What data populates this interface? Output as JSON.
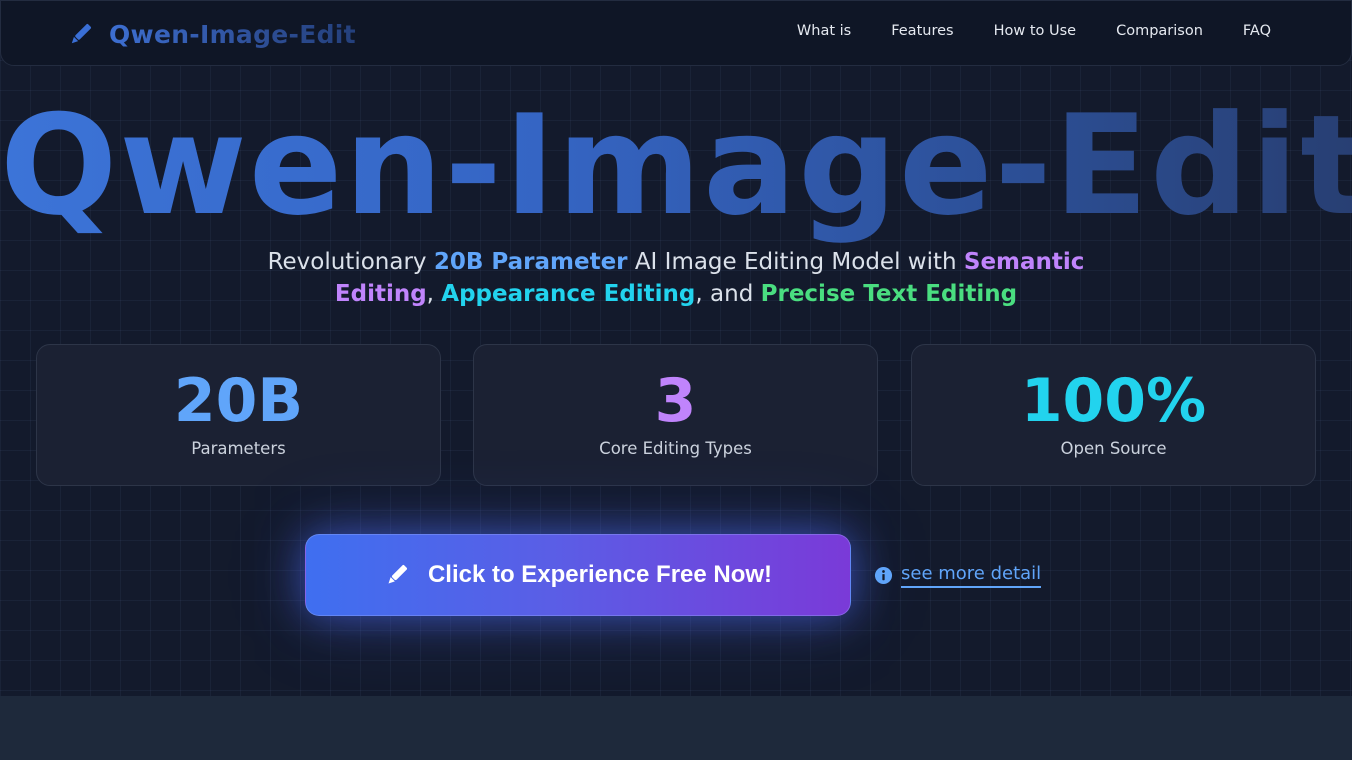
{
  "nav": {
    "brand": "Qwen-Image-Edit",
    "links": [
      {
        "label": "What is"
      },
      {
        "label": "Features"
      },
      {
        "label": "How to Use"
      },
      {
        "label": "Comparison"
      },
      {
        "label": "FAQ"
      }
    ]
  },
  "hero": {
    "title": "Qwen-Image-Edit",
    "subtitle": {
      "part1": "Revolutionary ",
      "hl1": "20B Parameter",
      "part2": " AI Image Editing Model with ",
      "hl2": "Semantic Editing",
      "part3": ", ",
      "hl3": "Appearance Editing",
      "part4": ", and ",
      "hl4": "Precise Text Editing"
    }
  },
  "stats": [
    {
      "value": "20B",
      "label": "Parameters",
      "color": "#60a5fa"
    },
    {
      "value": "3",
      "label": "Core Editing Types",
      "color": "#c084fc"
    },
    {
      "value": "100%",
      "label": "Open Source",
      "color": "#22d3ee"
    }
  ],
  "cta": {
    "label": "Click to Experience Free Now!",
    "icon": "pencil-icon",
    "detail_link": "see more detail",
    "detail_icon": "info-icon"
  },
  "colors": {
    "accent_blue": "#60a5fa",
    "accent_purple": "#c084fc",
    "accent_cyan": "#22d3ee",
    "accent_green": "#4ade80",
    "background": "#131a2c"
  }
}
